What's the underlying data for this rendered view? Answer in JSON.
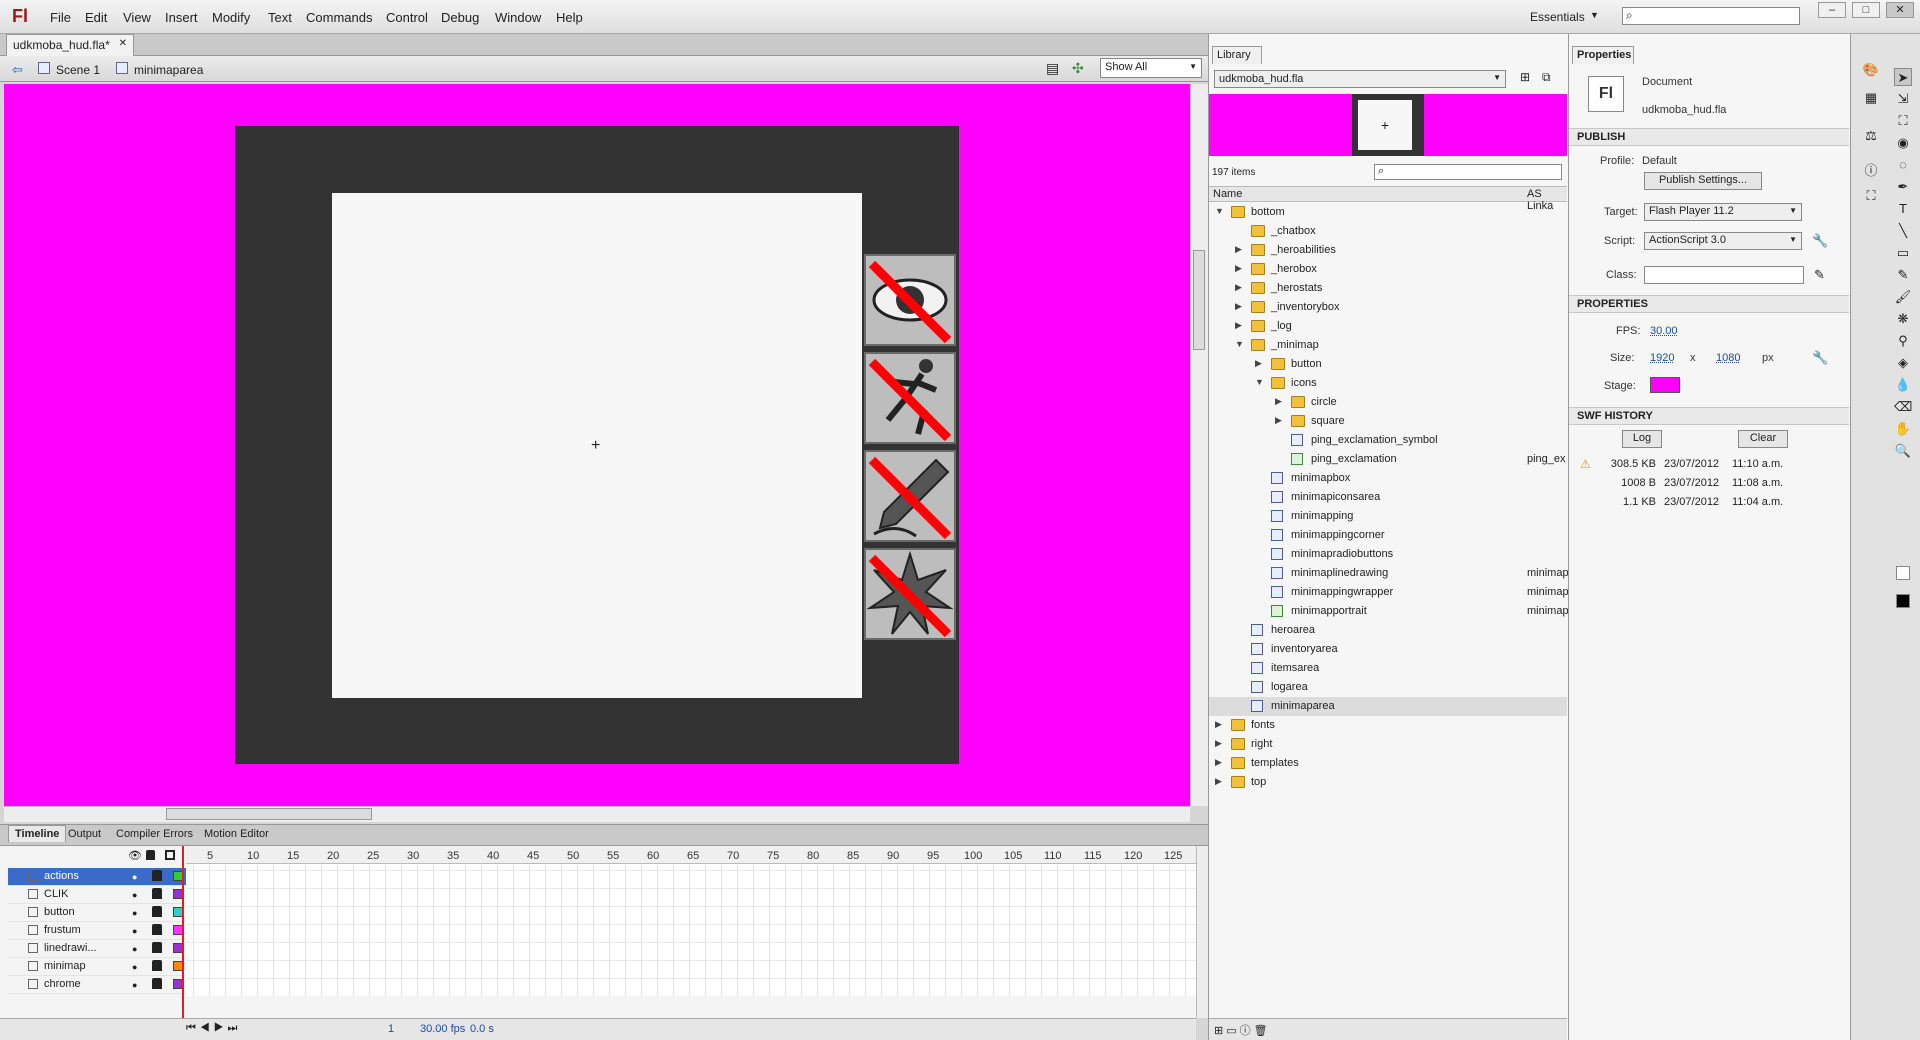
{
  "app": {
    "logo": "Fl",
    "menu": [
      "File",
      "Edit",
      "View",
      "Insert",
      "Modify",
      "Text",
      "Commands",
      "Control",
      "Debug",
      "Window",
      "Help"
    ],
    "workspace": "Essentials",
    "window_controls": [
      "–",
      "□",
      "✕"
    ]
  },
  "document": {
    "tab_label": "udkmoba_hud.fla*",
    "breadcrumb": [
      "Scene 1",
      "minimaparea"
    ],
    "zoom": "Show All"
  },
  "stage": {
    "background_color": "#ff00ff",
    "frame_color": "#333333",
    "inner_color": "#f7f7f7",
    "ping_buttons": [
      "eye-slash-icon",
      "running-man-slash-icon",
      "pencil-slash-icon",
      "explosion-slash-icon"
    ]
  },
  "timeline": {
    "tabs": [
      "Timeline",
      "Output",
      "Compiler Errors",
      "Motion Editor"
    ],
    "ruler": [
      "5",
      "10",
      "15",
      "20",
      "25",
      "30",
      "35",
      "40",
      "45",
      "50",
      "55",
      "60",
      "65",
      "70",
      "75",
      "80",
      "85",
      "90",
      "95",
      "100",
      "105",
      "110",
      "115",
      "120",
      "125"
    ],
    "layers": [
      {
        "name": "actions",
        "color": "#33cc33"
      },
      {
        "name": "CLIK",
        "color": "#9933cc"
      },
      {
        "name": "button",
        "color": "#33cccc"
      },
      {
        "name": "frustum",
        "color": "#ff33ff"
      },
      {
        "name": "linedrawi...",
        "color": "#9933cc"
      },
      {
        "name": "minimap",
        "color": "#ff8800"
      },
      {
        "name": "chrome",
        "color": "#9933cc"
      }
    ],
    "footer": {
      "frame": "1",
      "fps": "30.00 fps",
      "time": "0.0 s"
    }
  },
  "library": {
    "tab": "Library",
    "file": "udkmoba_hud.fla",
    "count": "197 items",
    "columns": {
      "name": "Name",
      "linkage": "AS Linka"
    },
    "items": [
      {
        "name": "bottom",
        "type": "folder",
        "depth": 0,
        "expand": "open"
      },
      {
        "name": "_chatbox",
        "type": "folder",
        "depth": 1,
        "expand": "none"
      },
      {
        "name": "_heroabilities",
        "type": "folder",
        "depth": 1,
        "expand": "closed"
      },
      {
        "name": "_herobox",
        "type": "folder",
        "depth": 1,
        "expand": "closed"
      },
      {
        "name": "_herostats",
        "type": "folder",
        "depth": 1,
        "expand": "closed"
      },
      {
        "name": "_inventorybox",
        "type": "folder",
        "depth": 1,
        "expand": "closed"
      },
      {
        "name": "_log",
        "type": "folder",
        "depth": 1,
        "expand": "closed"
      },
      {
        "name": "_minimap",
        "type": "folder",
        "depth": 1,
        "expand": "open"
      },
      {
        "name": "button",
        "type": "folder",
        "depth": 2,
        "expand": "closed"
      },
      {
        "name": "icons",
        "type": "folder",
        "depth": 2,
        "expand": "open"
      },
      {
        "name": "circle",
        "type": "folder",
        "depth": 3,
        "expand": "closed"
      },
      {
        "name": "square",
        "type": "folder",
        "depth": 3,
        "expand": "closed"
      },
      {
        "name": "ping_exclamation_symbol",
        "type": "symbol",
        "depth": 3,
        "expand": "none"
      },
      {
        "name": "ping_exclamation",
        "type": "bitmap",
        "depth": 3,
        "expand": "none",
        "linkage": "ping_ex"
      },
      {
        "name": "minimapbox",
        "type": "symbol",
        "depth": 2,
        "expand": "none"
      },
      {
        "name": "minimapiconsarea",
        "type": "symbol",
        "depth": 2,
        "expand": "none"
      },
      {
        "name": "minimapping",
        "type": "symbol",
        "depth": 2,
        "expand": "none"
      },
      {
        "name": "minimappingcorner",
        "type": "symbol",
        "depth": 2,
        "expand": "none"
      },
      {
        "name": "minimapradiobuttons",
        "type": "symbol",
        "depth": 2,
        "expand": "none"
      },
      {
        "name": "minimaplinedrawing",
        "type": "symbol",
        "depth": 2,
        "expand": "none",
        "linkage": "minimap"
      },
      {
        "name": "minimappingwrapper",
        "type": "symbol",
        "depth": 2,
        "expand": "none",
        "linkage": "minimap"
      },
      {
        "name": "minimapportrait",
        "type": "bitmap",
        "depth": 2,
        "expand": "none",
        "linkage": "minimap"
      },
      {
        "name": "heroarea",
        "type": "symbol",
        "depth": 1,
        "expand": "none"
      },
      {
        "name": "inventoryarea",
        "type": "symbol",
        "depth": 1,
        "expand": "none"
      },
      {
        "name": "itemsarea",
        "type": "symbol",
        "depth": 1,
        "expand": "none"
      },
      {
        "name": "logarea",
        "type": "symbol",
        "depth": 1,
        "expand": "none"
      },
      {
        "name": "minimaparea",
        "type": "symbol",
        "depth": 1,
        "expand": "none",
        "selected": true
      },
      {
        "name": "fonts",
        "type": "folder",
        "depth": 0,
        "expand": "closed"
      },
      {
        "name": "right",
        "type": "folder",
        "depth": 0,
        "expand": "closed"
      },
      {
        "name": "templates",
        "type": "folder",
        "depth": 0,
        "expand": "closed"
      },
      {
        "name": "top",
        "type": "folder",
        "depth": 0,
        "expand": "closed"
      }
    ]
  },
  "properties": {
    "tab": "Properties",
    "doc_icon": "Fl",
    "doc_type": "Document",
    "doc_name": "udkmoba_hud.fla",
    "publish": {
      "header": "PUBLISH",
      "profile_label": "Profile:",
      "profile": "Default",
      "settings_button": "Publish Settings...",
      "target_label": "Target:",
      "target": "Flash Player 11.2",
      "script_label": "Script:",
      "script": "ActionScript 3.0",
      "class_label": "Class:"
    },
    "props": {
      "header": "PROPERTIES",
      "fps_label": "FPS:",
      "fps": "30.00",
      "size_label": "Size:",
      "width": "1920",
      "x": "x",
      "height": "1080",
      "unit": "px",
      "stage_label": "Stage:",
      "stage_color": "#ff00ff"
    },
    "history": {
      "header": "SWF HISTORY",
      "log_button": "Log",
      "clear_button": "Clear",
      "entries": [
        {
          "size": "308.5 KB",
          "date": "23/07/2012",
          "time": "11:10 a.m."
        },
        {
          "size": "1008 B",
          "date": "23/07/2012",
          "time": "11:08 a.m."
        },
        {
          "size": "1.1 KB",
          "date": "23/07/2012",
          "time": "11:04 a.m."
        }
      ]
    }
  },
  "tools": [
    "selection-tool-icon",
    "subselection-tool-icon",
    "free-transform-tool-icon",
    "3d-rotation-tool-icon",
    "lasso-tool-icon",
    "pen-tool-icon",
    "text-tool-icon",
    "line-tool-icon",
    "rectangle-tool-icon",
    "pencil-tool-icon",
    "brush-tool-icon",
    "deco-tool-icon",
    "bone-tool-icon",
    "paint-bucket-tool-icon",
    "eyedropper-tool-icon",
    "eraser-tool-icon",
    "hand-tool-icon",
    "zoom-tool-icon"
  ]
}
